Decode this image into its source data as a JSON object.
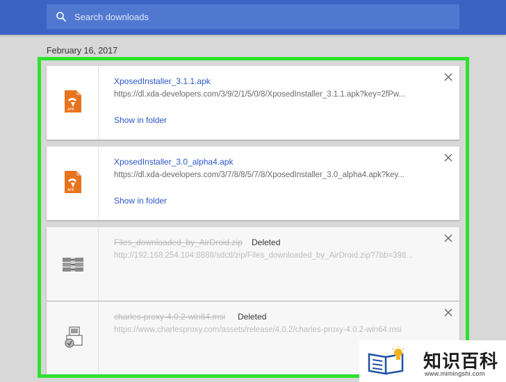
{
  "search": {
    "placeholder": "Search downloads"
  },
  "date_heading": "February 16, 2017",
  "downloads": [
    {
      "name": "XposedInstaller_3.1.1.apk",
      "url": "https://dl.xda-developers.com/3/9/2/1/5/0/8/XposedInstaller_3.1.1.apk?key=2fPw...",
      "action": "Show in folder",
      "status": "",
      "icon": "apk-file-icon"
    },
    {
      "name": "XposedInstaller_3.0_alpha4.apk",
      "url": "https://dl.xda-developers.com/3/7/8/8/5/7/8/XposedInstaller_3.0_alpha4.apk?key...",
      "action": "Show in folder",
      "status": "",
      "icon": "apk-file-icon"
    },
    {
      "name": "Files_downloaded_by_AirDroid.zip",
      "url": "http://192.168.254.104:8888/sdctl/zip/Files_downloaded_by_AirDroid.zip?7bb=398...",
      "action": "",
      "status": "Deleted",
      "icon": "zip-archive-icon"
    },
    {
      "name": "charles-proxy-4.0.2-win64.msi",
      "url": "https://www.charlesproxy.com/assets/release/4.0.2/charles-proxy-4.0.2-win64.msi",
      "action": "",
      "status": "Deleted",
      "icon": "msi-installer-icon"
    }
  ],
  "watermark": {
    "text": "知识百科",
    "url": "www.mimingshi.com"
  },
  "colors": {
    "header": "#3b63c4",
    "link": "#2a56c6",
    "highlight": "#2ee22e",
    "apk_icon": "#e8731d"
  }
}
